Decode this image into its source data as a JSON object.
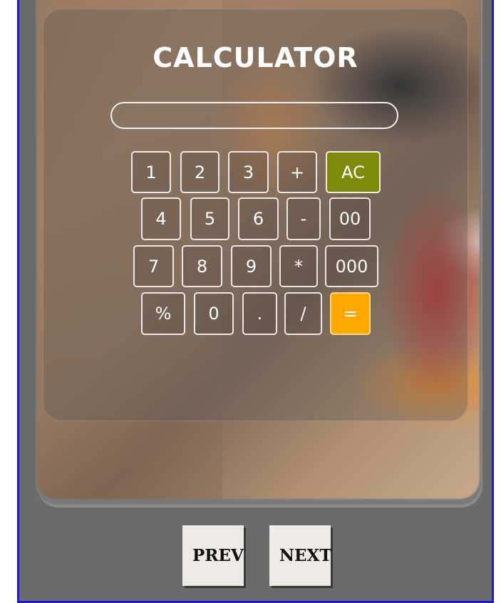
{
  "calculator": {
    "title": "CALCULATOR",
    "display_value": "",
    "keys": {
      "k1": "1",
      "k2": "2",
      "k3": "3",
      "plus": "+",
      "ac": "AC",
      "k4": "4",
      "k5": "5",
      "k6": "6",
      "minus": "-",
      "k00": "00",
      "k7": "7",
      "k8": "8",
      "k9": "9",
      "times": "*",
      "k000": "000",
      "percent": "%",
      "k0": "0",
      "dot": ".",
      "divide": "/",
      "equals": "="
    },
    "colors": {
      "ac": "#7f8a0c",
      "equals": "#ffa800"
    }
  },
  "nav": {
    "prev_label": "PREV",
    "next_label": "NEXT"
  }
}
